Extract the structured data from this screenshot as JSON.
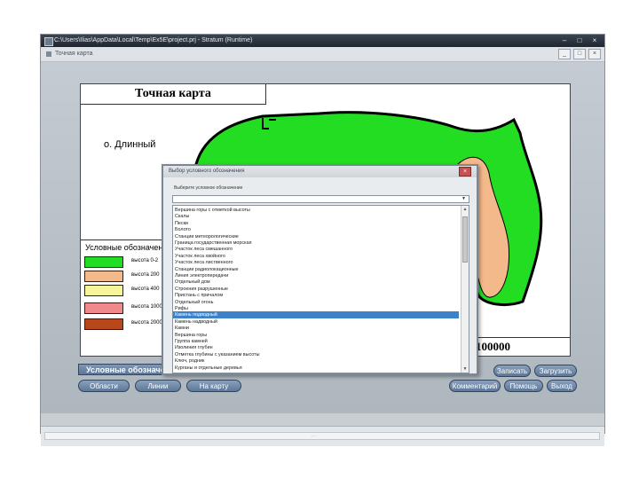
{
  "outer_window": {
    "title": "C:\\Users\\Ilias\\AppData\\Local\\Temp\\Ex5E\\project.prj - Stratum (Runtime)",
    "buttons": [
      "–",
      "□",
      "×"
    ]
  },
  "inner_window": {
    "title": "Точная карта",
    "buttons": [
      "_",
      "□",
      "×"
    ]
  },
  "map": {
    "title": "Точная карта",
    "island_label": "о. Длинный",
    "scale": "100000",
    "colors": {
      "green": "#22dd22",
      "peach": "#f4b98a",
      "outline": "#000000"
    }
  },
  "legend": {
    "title": "Условные обозначения",
    "items": [
      {
        "label": "высота 0-2",
        "color": "#22dd22"
      },
      {
        "label": "высота 200",
        "color": "#f4b98a"
      },
      {
        "label": "высота 400",
        "color": "#f7f59a"
      },
      {
        "label": "высота 1000-2000",
        "color": "#f08a8a"
      },
      {
        "label": "высота 2000-3",
        "color": "#b8481c"
      }
    ]
  },
  "bottom_panel": {
    "section_label": "Условные обозначения",
    "buttons_left": [
      "Области",
      "Линии",
      "На карту"
    ],
    "buttons_right": [
      "Записать",
      "Загрузить",
      "Комментарий",
      "Помощь",
      "Выход"
    ]
  },
  "dialog": {
    "title": "Выбор условного обозначения",
    "label": "Выберите условное обозначение",
    "select_value": "",
    "close": "×",
    "scroll_up": "▲",
    "scroll_down": "▼",
    "select_arrow": "▼",
    "selected_index": 16,
    "items": [
      "Вершина горы с отметкой высоты",
      "Скалы",
      "Пески",
      "Болото",
      "Станции метеорологические",
      "Граница государственная морская",
      "Участок леса смешанного",
      "Участок леса хвойного",
      "Участок леса лиственного",
      "Станции радиолокационные",
      "Линия электропередачи",
      "Отдельный дом",
      "Строения разрушенные",
      "Пристань с причалом",
      "Отдельный огонь",
      "Рифы",
      "Камень подводный",
      "Камень надводный",
      "Камни",
      "Вершина горы",
      "Группа камней",
      "Изолиния глубин",
      "Отметка глубины с указанием высоты",
      "Ключ, родник",
      "Курганы и отдельные деревья"
    ]
  },
  "statusbar": {
    "grip": "⋯"
  }
}
